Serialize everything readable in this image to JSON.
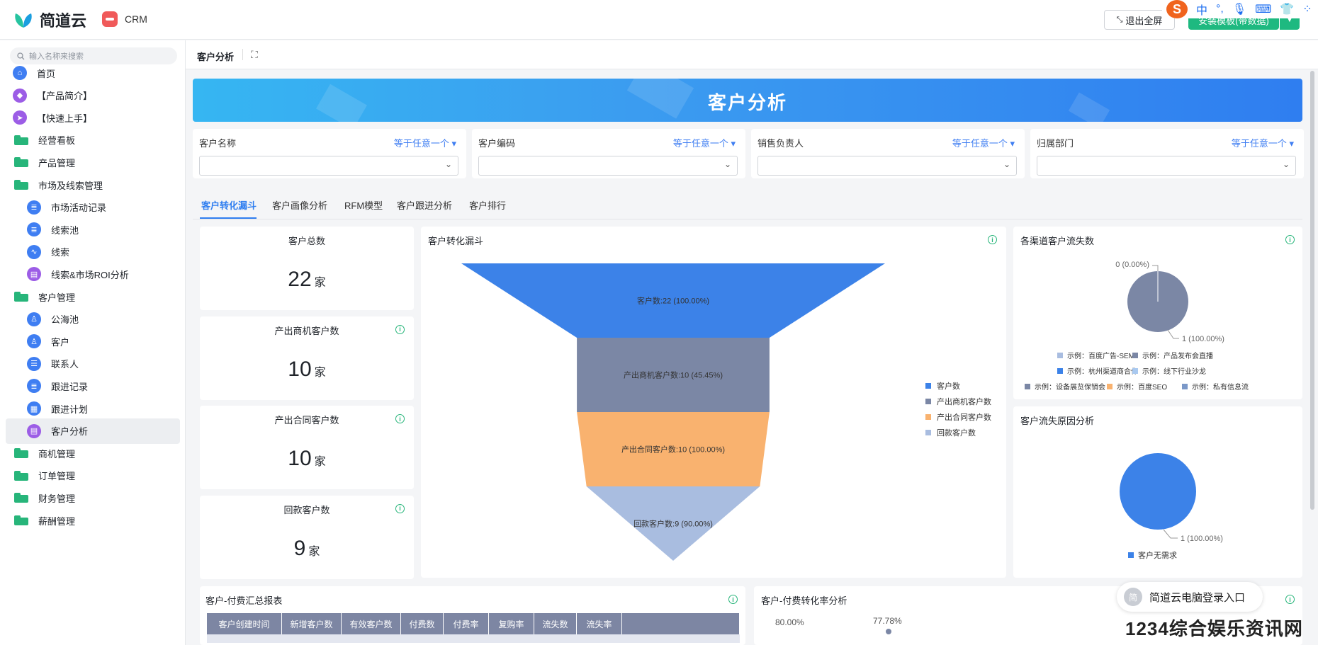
{
  "app": {
    "brand": "简道云",
    "module": "CRM",
    "exit_fullscreen": "退出全屏",
    "install_template": "安装模板(带数据)",
    "ime_chars": [
      "中",
      "°,"
    ]
  },
  "sidebar": {
    "search_placeholder": "输入名称来搜索",
    "items": [
      {
        "label": "首页",
        "icon": "home-icon",
        "kind": "top",
        "color": "#3f7ef2"
      },
      {
        "label": "【产品简介】",
        "icon": "tag-icon",
        "kind": "top",
        "color": "#9c5de6"
      },
      {
        "label": "【快速上手】",
        "icon": "send-icon",
        "kind": "top",
        "color": "#9c5de6"
      },
      {
        "label": "经营看板",
        "icon": "folder-icon",
        "kind": "folder"
      },
      {
        "label": "产品管理",
        "icon": "folder-icon",
        "kind": "folder"
      },
      {
        "label": "市场及线索管理",
        "icon": "folder-open-icon",
        "kind": "folder"
      },
      {
        "label": "市场活动记录",
        "icon": "form-icon",
        "kind": "child",
        "color": "#3f7ef2"
      },
      {
        "label": "线索池",
        "icon": "form-icon",
        "kind": "child",
        "color": "#3f7ef2"
      },
      {
        "label": "线索",
        "icon": "flow-icon",
        "kind": "child",
        "color": "#3f7ef2"
      },
      {
        "label": "线索&市场ROI分析",
        "icon": "report-icon",
        "kind": "child",
        "color": "#9c5de6"
      },
      {
        "label": "客户管理",
        "icon": "folder-open-icon",
        "kind": "folder"
      },
      {
        "label": "公海池",
        "icon": "user-icon",
        "kind": "child",
        "color": "#3f7ef2"
      },
      {
        "label": "客户",
        "icon": "user-icon",
        "kind": "child",
        "color": "#3f7ef2"
      },
      {
        "label": "联系人",
        "icon": "contact-icon",
        "kind": "child",
        "color": "#3f7ef2"
      },
      {
        "label": "跟进记录",
        "icon": "form-icon",
        "kind": "child",
        "color": "#3f7ef2"
      },
      {
        "label": "跟进计划",
        "icon": "calendar-icon",
        "kind": "child",
        "color": "#3f7ef2"
      },
      {
        "label": "客户分析",
        "icon": "report-icon",
        "kind": "child",
        "color": "#9c5de6",
        "active": true
      },
      {
        "label": "商机管理",
        "icon": "folder-icon",
        "kind": "folder"
      },
      {
        "label": "订单管理",
        "icon": "folder-icon",
        "kind": "folder"
      },
      {
        "label": "财务管理",
        "icon": "folder-icon",
        "kind": "folder"
      },
      {
        "label": "薪酬管理",
        "icon": "folder-icon",
        "kind": "folder"
      }
    ]
  },
  "page": {
    "tab_title": "客户分析",
    "banner_title": "客户分析"
  },
  "filters": [
    {
      "label": "客户名称",
      "op": "等于任意一个"
    },
    {
      "label": "客户编码",
      "op": "等于任意一个"
    },
    {
      "label": "销售负责人",
      "op": "等于任意一个"
    },
    {
      "label": "归属部门",
      "op": "等于任意一个"
    }
  ],
  "tabs": [
    "客户转化漏斗",
    "客户画像分析",
    "RFM模型",
    "客户跟进分析",
    "客户排行"
  ],
  "kpis": [
    {
      "title": "客户总数",
      "value": "22",
      "unit": "家",
      "info": false
    },
    {
      "title": "产出商机客户数",
      "value": "10",
      "unit": "家",
      "info": true
    },
    {
      "title": "产出合同客户数",
      "value": "10",
      "unit": "家",
      "info": true
    },
    {
      "title": "回款客户数",
      "value": "9",
      "unit": "家",
      "info": true
    }
  ],
  "charts": {
    "funnel_title": "客户转化漏斗",
    "channel_title": "各渠道客户流失数",
    "reason_title": "客户流失原因分析",
    "pay_summary_title": "客户-付费汇总报表",
    "pay_rate_title": "客户-付费转化率分析"
  },
  "chart_data": [
    {
      "type": "funnel",
      "title": "客户转化漏斗",
      "stages": [
        {
          "name": "客户数",
          "value": 22,
          "label": "客户数:22 (100.00%)",
          "color": "#3c82e8"
        },
        {
          "name": "产出商机客户数",
          "value": 10,
          "label": "产出商机客户数:10 (45.45%)",
          "color": "#7b87a5"
        },
        {
          "name": "产出合同客户数",
          "value": 10,
          "label": "产出合同客户数:10 (100.00%)",
          "color": "#f9b26f"
        },
        {
          "name": "回款客户数",
          "value": 9,
          "label": "回款客户数:9 (90.00%)",
          "color": "#a9bde0"
        }
      ],
      "legend": [
        "客户数",
        "产出商机客户数",
        "产出合同客户数",
        "回款客户数"
      ]
    },
    {
      "type": "pie",
      "title": "各渠道客户流失数",
      "labels": [
        "0 (0.00%)",
        "1 (100.00%)"
      ],
      "slice_color": "#7b87a5",
      "legend": [
        {
          "name": "示例：百度广告-SEM",
          "color": "#a9bde0"
        },
        {
          "name": "示例：产品发布会直播",
          "color": "#7b87a5"
        },
        {
          "name": "示例：杭州渠道商合作",
          "color": "#3c82e8"
        },
        {
          "name": "示例：线下行业沙龙",
          "color": "#a9c9f0"
        },
        {
          "name": "示例：设备展览保销会",
          "color": "#7b87a5"
        },
        {
          "name": "示例：百度SEO",
          "color": "#f9b26f"
        },
        {
          "name": "示例：私有信息流",
          "color": "#7b98c8"
        }
      ]
    },
    {
      "type": "pie",
      "title": "客户流失原因分析",
      "labels": [
        "1 (100.00%)"
      ],
      "legend": [
        {
          "name": "客户无需求",
          "color": "#3c82e8"
        }
      ],
      "slice_color": "#3c82e8"
    },
    {
      "type": "line",
      "title": "客户-付费转化率分析",
      "y_tick_label": "80.00%",
      "point_label": "77.78%"
    }
  ],
  "table": {
    "headers": [
      "客户创建时间",
      "新增客户数",
      "有效客户数",
      "付费数",
      "付费率",
      "复购率",
      "流失数",
      "流失率"
    ]
  },
  "float_tag": {
    "avatar": "简",
    "text": "简道云电脑登录入口"
  },
  "watermark": "1234综合娱乐资讯网"
}
